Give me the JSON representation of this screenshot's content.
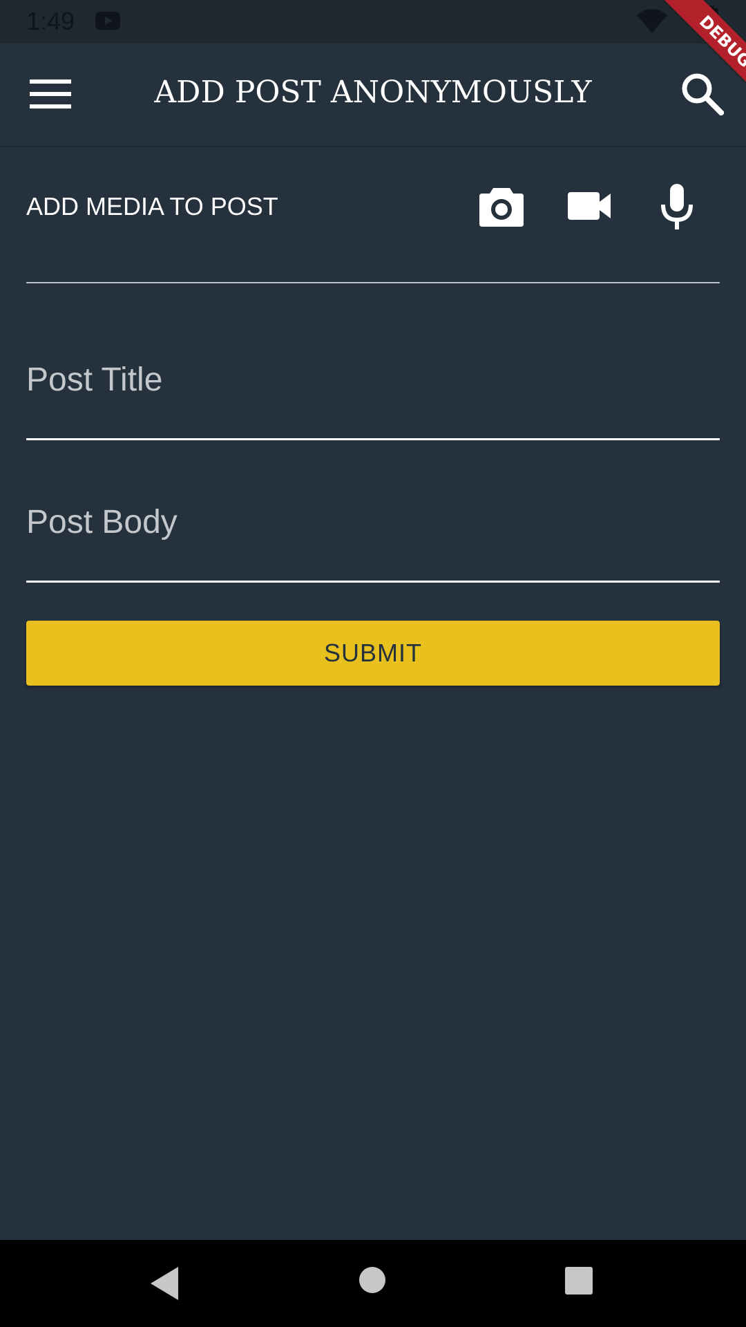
{
  "status_bar": {
    "time": "1:49",
    "icons": [
      "youtube-icon",
      "wifi-icon",
      "battery-icon"
    ]
  },
  "app_bar": {
    "title": "ADD POST ANONYMOUSLY",
    "left_icon": "menu-icon",
    "right_icon": "search-icon"
  },
  "debug_banner": {
    "label": "DEBUG",
    "color": "#b3222b"
  },
  "media": {
    "label": "ADD MEDIA TO POST",
    "icons": [
      "camera-icon",
      "video-icon",
      "mic-icon"
    ]
  },
  "form": {
    "title_placeholder": "Post Title",
    "body_placeholder": "Post Body",
    "submit_label": "SUBMIT"
  },
  "colors": {
    "background": "#25313c",
    "accent": "#e8c11f",
    "text": "#ffffff"
  },
  "nav_bar": {
    "icons": [
      "back-icon",
      "home-icon",
      "recents-icon"
    ]
  }
}
